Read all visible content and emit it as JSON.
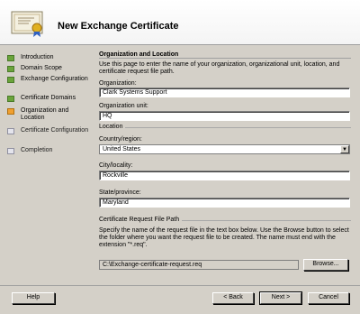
{
  "header": {
    "title": "New Exchange Certificate",
    "icon": "certificate-icon"
  },
  "steps": [
    {
      "label": "Introduction",
      "state": "done"
    },
    {
      "label": "Domain Scope",
      "state": "done"
    },
    {
      "label": "Exchange Configuration",
      "state": "done"
    },
    {
      "label": "Certificate Domains",
      "state": "done"
    },
    {
      "label": "Organization and Location",
      "state": "current"
    },
    {
      "label": "Certificate Configuration",
      "state": "todo"
    },
    {
      "label": "Completion",
      "state": "todo"
    }
  ],
  "content": {
    "title": "Organization and Location",
    "description": "Use this page to enter the name of your organization, organizational unit, location, and certificate request file path.",
    "organization": {
      "label": "Organization:",
      "value": "Clark Systems Support"
    },
    "org_unit": {
      "label": "Organization unit:",
      "value": "HQ"
    },
    "location_group": "Location",
    "country": {
      "label": "Country/region:",
      "value": "United States"
    },
    "city": {
      "label": "City/locality:",
      "value": "Rockville"
    },
    "state": {
      "label": "State/province:",
      "value": "Maryland"
    },
    "file_group": "Certificate Request File Path",
    "file_description": "Specify the name of the request file in the text box below. Use the Browse button to select the folder where you want the request file to be created. The name must end with the extension \"*.req\".",
    "file_path": "C:\\Exchange-certificate-request.req",
    "browse_label": "Browse..."
  },
  "footer": {
    "help_label": "Help",
    "back_label": "< Back",
    "next_label": "Next >",
    "cancel_label": "Cancel"
  }
}
